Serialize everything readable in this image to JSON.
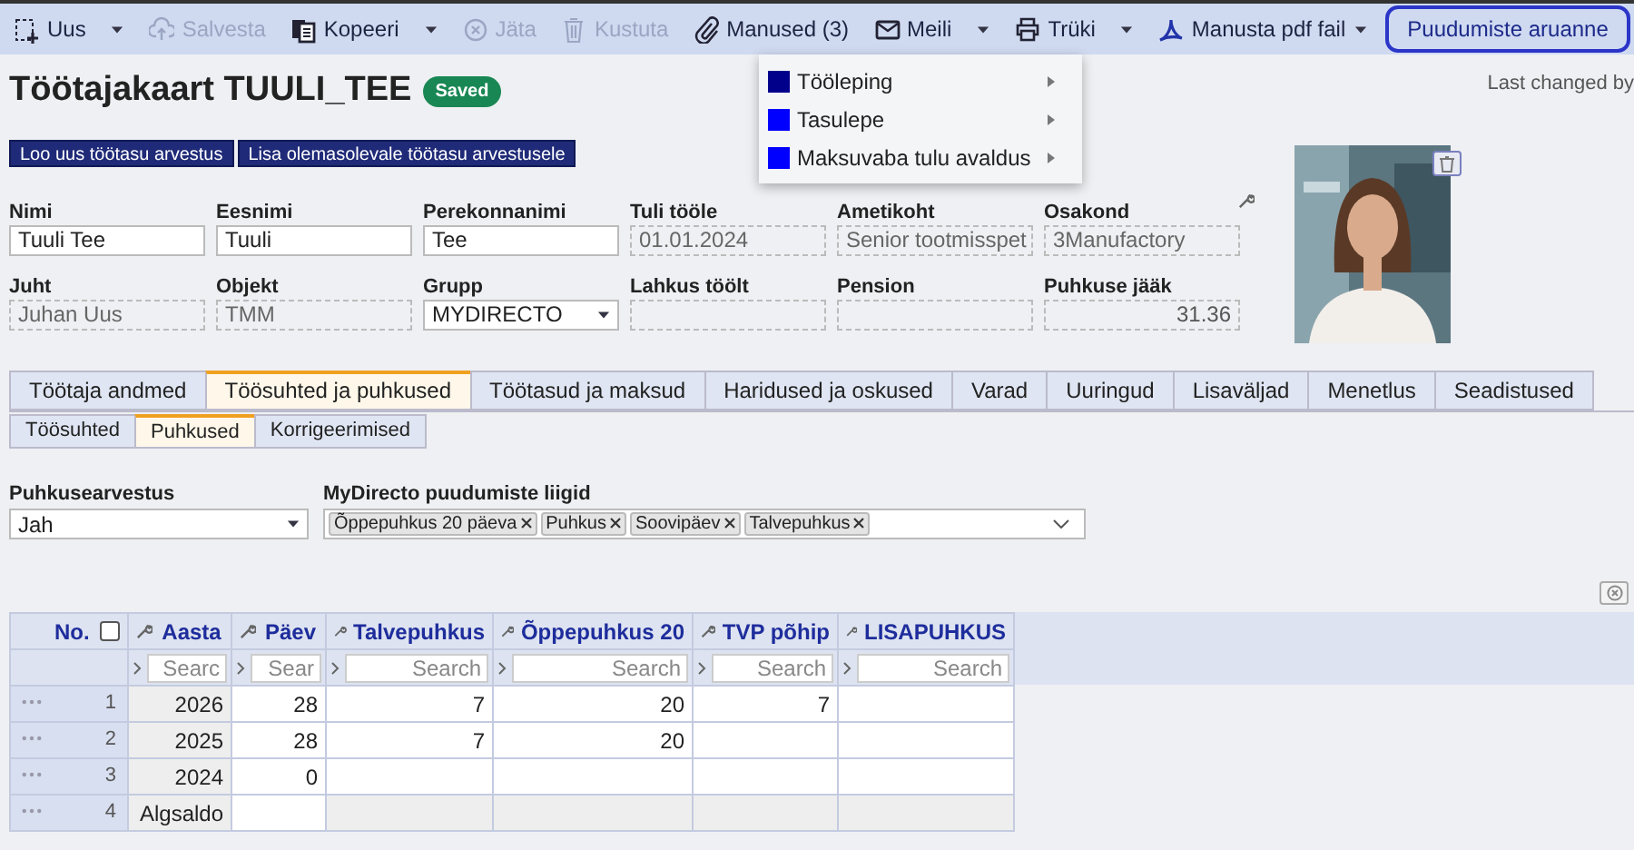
{
  "toolbar": {
    "buttons": [
      {
        "label": "Uus",
        "disabled": false,
        "caret": true
      },
      {
        "label": "Salvesta",
        "disabled": true,
        "caret": false
      },
      {
        "label": "Kopeeri",
        "disabled": false,
        "caret": true
      },
      {
        "label": "Jäta",
        "disabled": true,
        "caret": false
      },
      {
        "label": "Kustuta",
        "disabled": true,
        "caret": false
      },
      {
        "label": "Manused (3)",
        "disabled": false,
        "caret": false
      },
      {
        "label": "Meili",
        "disabled": false,
        "caret": true
      },
      {
        "label": "Trüki",
        "disabled": false,
        "caret": true
      },
      {
        "label": "Manusta pdf fail",
        "disabled": false,
        "caret": true
      }
    ],
    "report_button": {
      "label": "Puudumiste aruanne",
      "focused": true
    }
  },
  "print_menu": {
    "items": [
      {
        "label": "Tööleping",
        "color": "#00008b"
      },
      {
        "label": "Tasulepe",
        "color": "#0000ff"
      },
      {
        "label": "Maksuvaba tulu avaldus",
        "color": "#0000ff"
      }
    ]
  },
  "title": "Töötajakaart TUULI_TEE",
  "status_badge": "Saved",
  "last_changed": "Last changed by",
  "actions": [
    "Loo uus töötasu arvestus",
    "Lisa olemasolevale töötasu arvestusele"
  ],
  "fields": [
    {
      "label": "Nimi",
      "value": "Tuuli Tee",
      "kind": "input"
    },
    {
      "label": "Eesnimi",
      "value": "Tuuli",
      "kind": "input"
    },
    {
      "label": "Perekonnanimi",
      "value": "Tee",
      "kind": "input"
    },
    {
      "label": "Tuli tööle",
      "value": "01.01.2024",
      "kind": "readonly"
    },
    {
      "label": "Ametikoht",
      "value": "Senior tootmisspet",
      "kind": "readonly"
    },
    {
      "label": "Osakond",
      "value": "3Manufactory",
      "kind": "readonly"
    },
    {
      "label": "Juht",
      "value": "Juhan Uus",
      "kind": "readonly"
    },
    {
      "label": "Objekt",
      "value": "TMM",
      "kind": "readonly"
    },
    {
      "label": "Grupp",
      "value": "MYDIRECTO",
      "kind": "select"
    },
    {
      "label": "Lahkus töölt",
      "kind": "readonly"
    },
    {
      "label": "Pension",
      "kind": "readonly"
    },
    {
      "label": "Puhkuse jääk",
      "value": "31.36",
      "kind": "number"
    }
  ],
  "tabs": [
    {
      "label": "Töötaja andmed",
      "selected": false
    },
    {
      "label": "Töösuhted ja puhkused",
      "selected": true
    },
    {
      "label": "Töötasud ja maksud",
      "selected": false
    },
    {
      "label": "Haridused ja oskused",
      "selected": false
    },
    {
      "label": "Varad",
      "selected": false
    },
    {
      "label": "Uuringud",
      "selected": false
    },
    {
      "label": "Lisaväljad",
      "selected": false
    },
    {
      "label": "Menetlus",
      "selected": false
    },
    {
      "label": "Seadistused",
      "selected": false
    }
  ],
  "subtabs": [
    {
      "label": "Töösuhted",
      "selected": false
    },
    {
      "label": "Puhkused",
      "selected": true
    },
    {
      "label": "Korrigeerimised",
      "selected": false
    }
  ],
  "vacation_calc": {
    "label": "Puhkusearvestus",
    "value": "Jah"
  },
  "absence_types": {
    "label": "MyDirecto puudumiste liigid",
    "tags": [
      "Õppepuhkus 20 päeva",
      "Puhkus",
      "Soovipäev",
      "Talvepuhkus"
    ]
  },
  "table": {
    "columns": [
      {
        "label": "No.",
        "checked": false
      },
      {
        "label": "Aasta",
        "placeholder": "Searc"
      },
      {
        "label": "Päev",
        "placeholder": "Sear"
      },
      {
        "label": "Talvepuhkus",
        "placeholder": "Search"
      },
      {
        "label": "Õppepuhkus 20",
        "placeholder": "Search"
      },
      {
        "label": "TVP põhip",
        "placeholder": "Search"
      },
      {
        "label": "LISAPUHKUS",
        "placeholder": "Search"
      }
    ],
    "rows": [
      {
        "locked": false,
        "cells": [
          "1",
          "2026",
          "28",
          "7",
          "20",
          "7",
          ""
        ]
      },
      {
        "locked": false,
        "cells": [
          "2",
          "2025",
          "28",
          "7",
          "20",
          "",
          ""
        ]
      },
      {
        "locked": false,
        "cells": [
          "3",
          "2024",
          "0",
          "",
          "",
          "",
          ""
        ]
      },
      {
        "locked": true,
        "cells": [
          "4",
          "Algsaldo",
          "",
          "",
          "",
          "",
          ""
        ]
      }
    ]
  }
}
